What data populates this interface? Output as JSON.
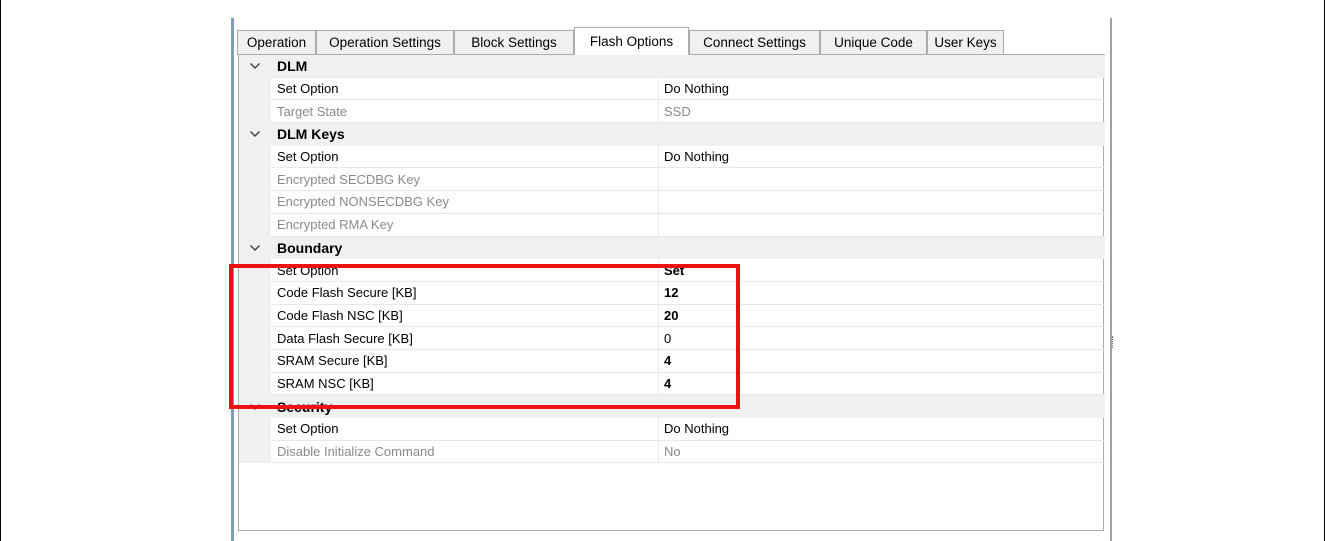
{
  "tabs": [
    {
      "label": "Operation",
      "active": false
    },
    {
      "label": "Operation Settings",
      "active": false
    },
    {
      "label": "Block Settings",
      "active": false
    },
    {
      "label": "Flash Options",
      "active": true
    },
    {
      "label": "Connect Settings",
      "active": false
    },
    {
      "label": "Unique Code",
      "active": false
    },
    {
      "label": "User Keys",
      "active": false
    }
  ],
  "categories": [
    {
      "name": "DLM",
      "rows": [
        {
          "name": "Set Option",
          "value": "Do Nothing",
          "disabled": false,
          "bold": false
        },
        {
          "name": "Target State",
          "value": "SSD",
          "disabled": true,
          "bold": false
        }
      ]
    },
    {
      "name": "DLM Keys",
      "rows": [
        {
          "name": "Set Option",
          "value": "Do Nothing",
          "disabled": false,
          "bold": false
        },
        {
          "name": "Encrypted SECDBG Key",
          "value": "",
          "disabled": true,
          "bold": false
        },
        {
          "name": "Encrypted NONSECDBG Key",
          "value": "",
          "disabled": true,
          "bold": false
        },
        {
          "name": "Encrypted RMA Key",
          "value": "",
          "disabled": true,
          "bold": false
        }
      ]
    },
    {
      "name": "Boundary",
      "rows": [
        {
          "name": "Set Option",
          "value": "Set",
          "disabled": false,
          "bold": true
        },
        {
          "name": "Code Flash Secure [KB]",
          "value": "12",
          "disabled": false,
          "bold": true
        },
        {
          "name": "Code Flash NSC [KB]",
          "value": "20",
          "disabled": false,
          "bold": true
        },
        {
          "name": "Data Flash Secure [KB]",
          "value": "0",
          "disabled": false,
          "bold": false
        },
        {
          "name": "SRAM Secure [KB]",
          "value": "4",
          "disabled": false,
          "bold": true
        },
        {
          "name": "SRAM NSC [KB]",
          "value": "4",
          "disabled": false,
          "bold": true
        }
      ]
    },
    {
      "name": "Security",
      "rows": [
        {
          "name": "Set Option",
          "value": "Do Nothing",
          "disabled": false,
          "bold": false
        },
        {
          "name": "Disable Initialize Command",
          "value": "No",
          "disabled": true,
          "bold": false
        }
      ]
    }
  ],
  "colors": {
    "highlight_border": "#ee1111",
    "category_bg": "#f0f0f0",
    "disabled_text": "#8a8a8a"
  },
  "icons": {
    "expander": "chevron-down-icon"
  }
}
